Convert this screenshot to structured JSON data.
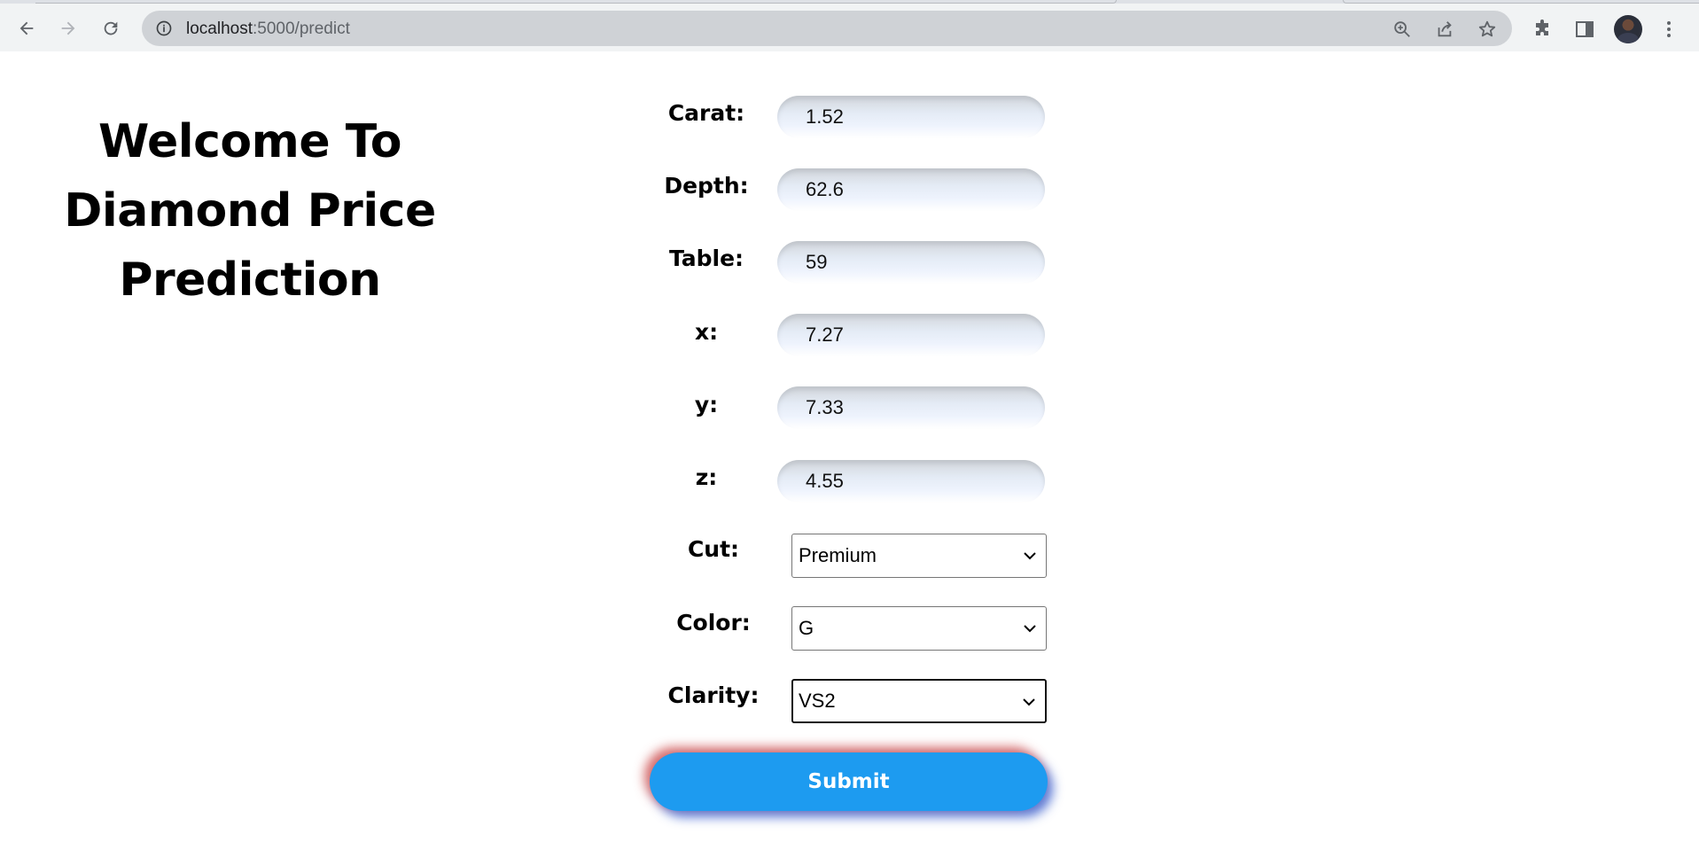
{
  "browser": {
    "url_host": "localhost",
    "url_path": ":5000/predict",
    "icons": {
      "back": "back-arrow-icon",
      "forward": "forward-arrow-icon",
      "reload": "reload-icon",
      "site_info": "info-icon",
      "zoom": "zoom-icon",
      "share": "share-icon",
      "bookmark": "star-icon",
      "extensions": "puzzle-icon",
      "side_panel": "side-panel-icon",
      "menu": "kebab-menu-icon"
    }
  },
  "page": {
    "heading": {
      "line1": "Welcome To",
      "line2": "Diamond Price",
      "line3": "Prediction"
    },
    "fields": {
      "carat": {
        "label": "Carat:",
        "value": "1.52"
      },
      "depth": {
        "label": "Depth:",
        "value": "62.6"
      },
      "table": {
        "label": "Table:",
        "value": "59"
      },
      "x": {
        "label": "x:",
        "value": "7.27"
      },
      "y": {
        "label": "y:",
        "value": "7.33"
      },
      "z": {
        "label": "z:",
        "value": "4.55"
      },
      "cut": {
        "label": "Cut:",
        "selected": "Premium"
      },
      "color": {
        "label": "Color:",
        "selected": "G"
      },
      "clarity": {
        "label": "Clarity:",
        "selected": "VS2"
      }
    },
    "submit_label": "Submit",
    "colors": {
      "submit_bg": "#1d9bf0",
      "submit_text": "#ffffff"
    }
  }
}
